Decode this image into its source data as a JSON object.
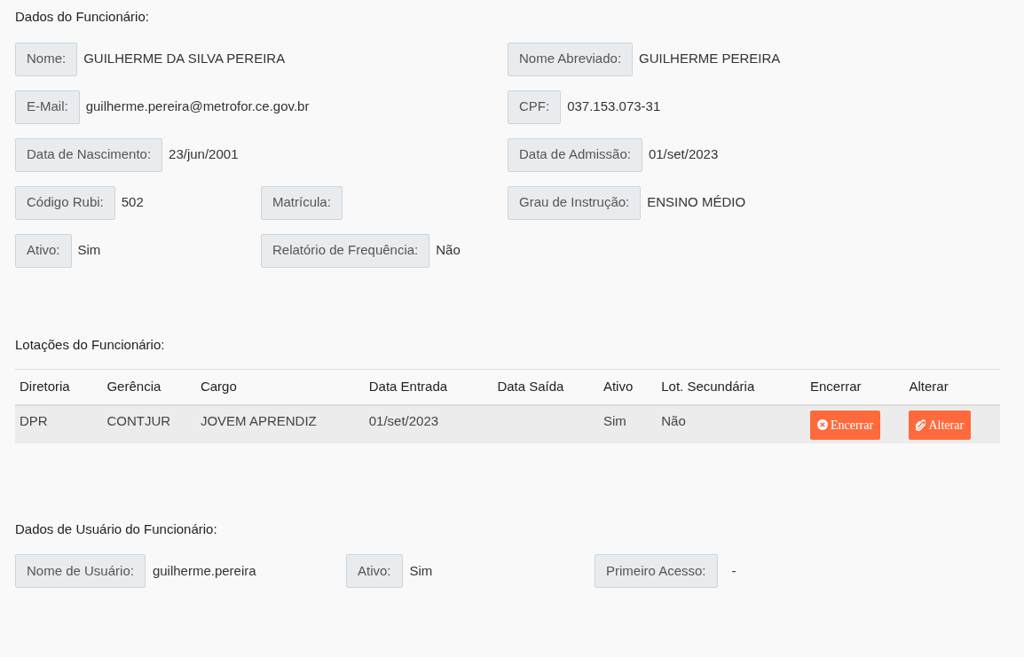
{
  "employee": {
    "title": "Dados do Funcionário:",
    "rows": [
      {
        "left": [
          {
            "label": "Nome:",
            "value": "GUILHERME DA SILVA PEREIRA"
          }
        ],
        "right": [
          {
            "label": "Nome Abreviado:",
            "value": "GUILHERME PEREIRA"
          }
        ]
      },
      {
        "left": [
          {
            "label": "E-Mail:",
            "value": "guilherme.pereira@metrofor.ce.gov.br"
          }
        ],
        "right": [
          {
            "label": "CPF:",
            "value": "037.153.073-31"
          }
        ]
      },
      {
        "left": [
          {
            "label": "Data de Nascimento:",
            "value": "23/jun/2001"
          }
        ],
        "right": [
          {
            "label": "Data de Admissão:",
            "value": "01/set/2023"
          }
        ]
      },
      {
        "left": [
          {
            "label": "Código Rubi:",
            "value": "502"
          },
          {
            "label": "Matrícula:"
          }
        ],
        "right": [
          {
            "label": "Grau de Instrução:",
            "value": "ENSINO MÉDIO"
          }
        ]
      },
      {
        "left": [
          {
            "label": "Ativo:",
            "value": "Sim"
          },
          {
            "label": "Relatório de Frequência:",
            "value": "Não"
          }
        ],
        "right": []
      }
    ]
  },
  "assignments": {
    "title": "Lotações do Funcionário:",
    "columns": [
      "Diretoria",
      "Gerência",
      "Cargo",
      "Data Entrada",
      "Data Saída",
      "Ativo",
      "Lot. Secundária",
      "Encerrar",
      "Alterar"
    ],
    "rows": [
      {
        "cells": [
          "DPR",
          "CONTJUR",
          "JOVEM APRENDIZ",
          "01/set/2023",
          null,
          "Sim",
          "Não"
        ],
        "actions": [
          {
            "kind": "close",
            "label": "Encerrar"
          },
          {
            "kind": "edit",
            "label": "Alterar"
          }
        ]
      }
    ]
  },
  "user": {
    "title": "Dados de Usuário do Funcionário:",
    "fields": [
      {
        "label": "Nome de Usuário:",
        "value": "guilherme.pereira"
      },
      {
        "label": "Ativo:",
        "value": "Sim"
      },
      {
        "label": "Primeiro Acesso:",
        "value": "-"
      }
    ]
  }
}
